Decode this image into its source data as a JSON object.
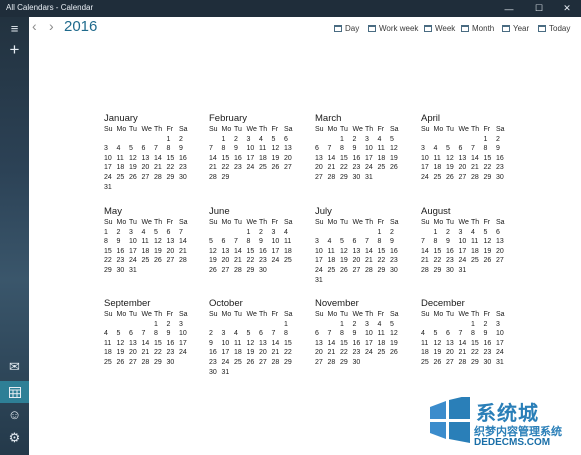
{
  "window": {
    "title": "All Calendars - Calendar",
    "minimize": "—",
    "maximize": "☐",
    "close": "✕"
  },
  "toolbar": {
    "year": "2016",
    "prev": "‹",
    "next": "›",
    "views": [
      "Day",
      "Work week",
      "Week",
      "Month",
      "Year",
      "Today"
    ]
  },
  "sidebar": {
    "hamburger": "≡",
    "add": "+",
    "mail": "✉",
    "people": "☺",
    "settings": "⚙"
  },
  "weekday_headers": [
    "Su",
    "Mo",
    "Tu",
    "We",
    "Th",
    "Fr",
    "Sa"
  ],
  "months": [
    {
      "name": "January",
      "weeks": [
        [
          "",
          "",
          "",
          "",
          "",
          "1",
          "2"
        ],
        [
          "3",
          "4",
          "5",
          "6",
          "7",
          "8",
          "9"
        ],
        [
          "10",
          "11",
          "12",
          "13",
          "14",
          "15",
          "16"
        ],
        [
          "17",
          "18",
          "19",
          "20",
          "21",
          "22",
          "23"
        ],
        [
          "24",
          "25",
          "26",
          "27",
          "28",
          "29",
          "30"
        ],
        [
          "31",
          "",
          "",
          "",
          "",
          "",
          ""
        ]
      ]
    },
    {
      "name": "February",
      "weeks": [
        [
          "",
          "1",
          "2",
          "3",
          "4",
          "5",
          "6"
        ],
        [
          "7",
          "8",
          "9",
          "10",
          "11",
          "12",
          "13"
        ],
        [
          "14",
          "15",
          "16",
          "17",
          "18",
          "19",
          "20"
        ],
        [
          "21",
          "22",
          "23",
          "24",
          "25",
          "26",
          "27"
        ],
        [
          "28",
          "29",
          "",
          "",
          "",
          "",
          ""
        ]
      ]
    },
    {
      "name": "March",
      "weeks": [
        [
          "",
          "",
          "1",
          "2",
          "3",
          "4",
          "5"
        ],
        [
          "6",
          "7",
          "8",
          "9",
          "10",
          "11",
          "12"
        ],
        [
          "13",
          "14",
          "15",
          "16",
          "17",
          "18",
          "19"
        ],
        [
          "20",
          "21",
          "22",
          "23",
          "24",
          "25",
          "26"
        ],
        [
          "27",
          "28",
          "29",
          "30",
          "31",
          "",
          ""
        ]
      ]
    },
    {
      "name": "April",
      "weeks": [
        [
          "",
          "",
          "",
          "",
          "",
          "1",
          "2"
        ],
        [
          "3",
          "4",
          "5",
          "6",
          "7",
          "8",
          "9"
        ],
        [
          "10",
          "11",
          "12",
          "13",
          "14",
          "15",
          "16"
        ],
        [
          "17",
          "18",
          "19",
          "20",
          "21",
          "22",
          "23"
        ],
        [
          "24",
          "25",
          "26",
          "27",
          "28",
          "29",
          "30"
        ]
      ]
    },
    {
      "name": "May",
      "weeks": [
        [
          "1",
          "2",
          "3",
          "4",
          "5",
          "6",
          "7"
        ],
        [
          "8",
          "9",
          "10",
          "11",
          "12",
          "13",
          "14"
        ],
        [
          "15",
          "16",
          "17",
          "18",
          "19",
          "20",
          "21"
        ],
        [
          "22",
          "23",
          "24",
          "25",
          "26",
          "27",
          "28"
        ],
        [
          "29",
          "30",
          "31",
          "",
          "",
          "",
          ""
        ]
      ]
    },
    {
      "name": "June",
      "weeks": [
        [
          "",
          "",
          "",
          "1",
          "2",
          "3",
          "4"
        ],
        [
          "5",
          "6",
          "7",
          "8",
          "9",
          "10",
          "11"
        ],
        [
          "12",
          "13",
          "14",
          "15",
          "16",
          "17",
          "18"
        ],
        [
          "19",
          "20",
          "21",
          "22",
          "23",
          "24",
          "25"
        ],
        [
          "26",
          "27",
          "28",
          "29",
          "30",
          "",
          ""
        ]
      ]
    },
    {
      "name": "July",
      "weeks": [
        [
          "",
          "",
          "",
          "",
          "",
          "1",
          "2"
        ],
        [
          "3",
          "4",
          "5",
          "6",
          "7",
          "8",
          "9"
        ],
        [
          "10",
          "11",
          "12",
          "13",
          "14",
          "15",
          "16"
        ],
        [
          "17",
          "18",
          "19",
          "20",
          "21",
          "22",
          "23"
        ],
        [
          "24",
          "25",
          "26",
          "27",
          "28",
          "29",
          "30"
        ],
        [
          "31",
          "",
          "",
          "",
          "",
          "",
          ""
        ]
      ]
    },
    {
      "name": "August",
      "weeks": [
        [
          "",
          "1",
          "2",
          "3",
          "4",
          "5",
          "6"
        ],
        [
          "7",
          "8",
          "9",
          "10",
          "11",
          "12",
          "13"
        ],
        [
          "14",
          "15",
          "16",
          "17",
          "18",
          "19",
          "20"
        ],
        [
          "21",
          "22",
          "23",
          "24",
          "25",
          "26",
          "27"
        ],
        [
          "28",
          "29",
          "30",
          "31",
          "",
          "",
          ""
        ]
      ]
    },
    {
      "name": "September",
      "weeks": [
        [
          "",
          "",
          "",
          "",
          "1",
          "2",
          "3"
        ],
        [
          "4",
          "5",
          "6",
          "7",
          "8",
          "9",
          "10"
        ],
        [
          "11",
          "12",
          "13",
          "14",
          "15",
          "16",
          "17"
        ],
        [
          "18",
          "19",
          "20",
          "21",
          "22",
          "23",
          "24"
        ],
        [
          "25",
          "26",
          "27",
          "28",
          "29",
          "30",
          ""
        ]
      ]
    },
    {
      "name": "October",
      "weeks": [
        [
          "",
          "",
          "",
          "",
          "",
          "",
          "1"
        ],
        [
          "2",
          "3",
          "4",
          "5",
          "6",
          "7",
          "8"
        ],
        [
          "9",
          "10",
          "11",
          "12",
          "13",
          "14",
          "15"
        ],
        [
          "16",
          "17",
          "18",
          "19",
          "20",
          "21",
          "22"
        ],
        [
          "23",
          "24",
          "25",
          "26",
          "27",
          "28",
          "29"
        ],
        [
          "30",
          "31",
          "",
          "",
          "",
          "",
          ""
        ]
      ]
    },
    {
      "name": "November",
      "weeks": [
        [
          "",
          "",
          "1",
          "2",
          "3",
          "4",
          "5"
        ],
        [
          "6",
          "7",
          "8",
          "9",
          "10",
          "11",
          "12"
        ],
        [
          "13",
          "14",
          "15",
          "16",
          "17",
          "18",
          "19"
        ],
        [
          "20",
          "21",
          "22",
          "23",
          "24",
          "25",
          "26"
        ],
        [
          "27",
          "28",
          "29",
          "30",
          "",
          "",
          ""
        ]
      ]
    },
    {
      "name": "December",
      "weeks": [
        [
          "",
          "",
          "",
          "",
          "1",
          "2",
          "3"
        ],
        [
          "4",
          "5",
          "6",
          "7",
          "8",
          "9",
          "10"
        ],
        [
          "11",
          "12",
          "13",
          "14",
          "15",
          "16",
          "17"
        ],
        [
          "18",
          "19",
          "20",
          "21",
          "22",
          "23",
          "24"
        ],
        [
          "25",
          "26",
          "27",
          "28",
          "29",
          "30",
          "31"
        ]
      ]
    }
  ],
  "watermark": {
    "line1": "系统城",
    "line2": "织梦内容管理系统",
    "line3": "DEDECMS.COM",
    "brand_color": "#2a7fb8"
  }
}
